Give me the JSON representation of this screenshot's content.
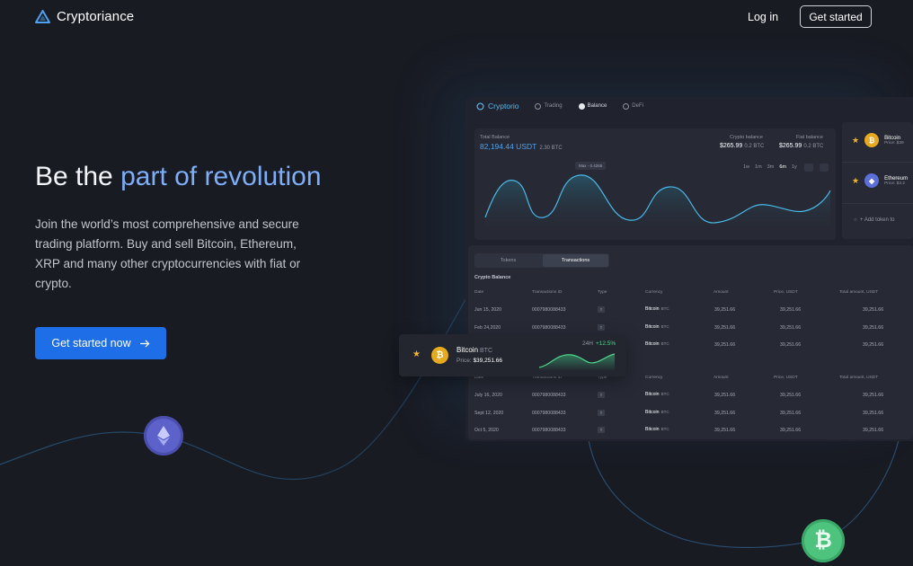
{
  "nav": {
    "brand": "Cryptoriance",
    "login": "Log in",
    "get_started": "Get started"
  },
  "hero": {
    "title_a": "Be the ",
    "title_b": "part of revolution",
    "subtitle": "Join the world’s most comprehensive and secure trading platform. Buy and sell Bitcoin, Ethereum, XRP and many other cryptocurrencies with fiat or crypto.",
    "cta": "Get started now"
  },
  "dashboard": {
    "brand": "Cryptorio",
    "tabs": [
      "Trading",
      "Balance",
      "DeFi"
    ],
    "active_tab": "Balance",
    "total_balance_label": "Total Balance",
    "total_balance_value": "82,194.44 USDT",
    "total_balance_btc": "2.30 BTC",
    "crypto_balance_label": "Crypto balance",
    "crypto_balance_value": "$265.99",
    "crypto_balance_btc": "0.2 BTC",
    "fiat_balance_label": "Fiat balance",
    "fiat_balance_value": "$265.99",
    "fiat_balance_btc": "0.2 BTC",
    "max_tooltip": "Max - 0.4265",
    "ranges": [
      "1w",
      "1m",
      "3m",
      "6m",
      "1y"
    ],
    "active_range": "6m",
    "side": {
      "btc_name": "Bitcoin",
      "btc_price": "Price: $39",
      "eth_name": "Ethereum",
      "eth_price": "Price: $3.2",
      "add": "Add token to"
    },
    "tx": {
      "tab_tokens": "Tokens",
      "tab_transactions": "Transactions",
      "section": "Crypto Balance",
      "headers": [
        "Date",
        "Transactions ID",
        "Type",
        "Currency",
        "Amount",
        "Price, USDT",
        "Total amount, USDT"
      ],
      "rows_top": [
        {
          "date": "Jun 15, 2020",
          "id": "0007980088433",
          "type": "↑",
          "coin": "Bitcoin",
          "sym": "BTC",
          "amount": "39,251.66",
          "price": "39,251.66",
          "total": "39,251.66"
        },
        {
          "date": "Feb 24,2020",
          "id": "0007980088433",
          "type": "↑",
          "coin": "Bitcoin",
          "sym": "BTC",
          "amount": "39,251.66",
          "price": "39,251.66",
          "total": "39,251.66"
        },
        {
          "date": "",
          "id": "",
          "type": "",
          "coin": "Bitcoin",
          "sym": "BTC",
          "amount": "39,251.66",
          "price": "39,251.66",
          "total": "39,251.66"
        }
      ],
      "rows_bottom": [
        {
          "date": "July 16, 2020",
          "id": "0007980088433",
          "type": "↑",
          "coin": "Bitcoin",
          "sym": "BTC",
          "amount": "39,251.66",
          "price": "39,251.66",
          "total": "39,251.66"
        },
        {
          "date": "Sept 12, 2020",
          "id": "0007980088433",
          "type": "↑",
          "coin": "Bitcoin",
          "sym": "BTC",
          "amount": "39,251.66",
          "price": "39,251.66",
          "total": "39,251.66"
        },
        {
          "date": "Oct 5, 2020",
          "id": "0007980088433",
          "type": "↑",
          "coin": "Bitcoin",
          "sym": "BTC",
          "amount": "39,251.66",
          "price": "39,251.66",
          "total": "39,251.66"
        }
      ]
    }
  },
  "float_card": {
    "name": "Bitcoin",
    "symbol": "BTC",
    "price_label": "Price:",
    "price": "$39,251.66",
    "period": "24H",
    "change": "+12.5%"
  },
  "icons": {
    "logo": "cryptoriance-logo-icon",
    "arrow": "arrow-right-icon",
    "star": "star-icon",
    "eth_coin": "ethereum-coin-icon",
    "btc_coin": "bitcoin-coin-icon"
  },
  "colors": {
    "bg": "#191b23",
    "accent": "#1e6ee8",
    "highlight": "#7eaef7",
    "positive": "#4fd58d"
  }
}
